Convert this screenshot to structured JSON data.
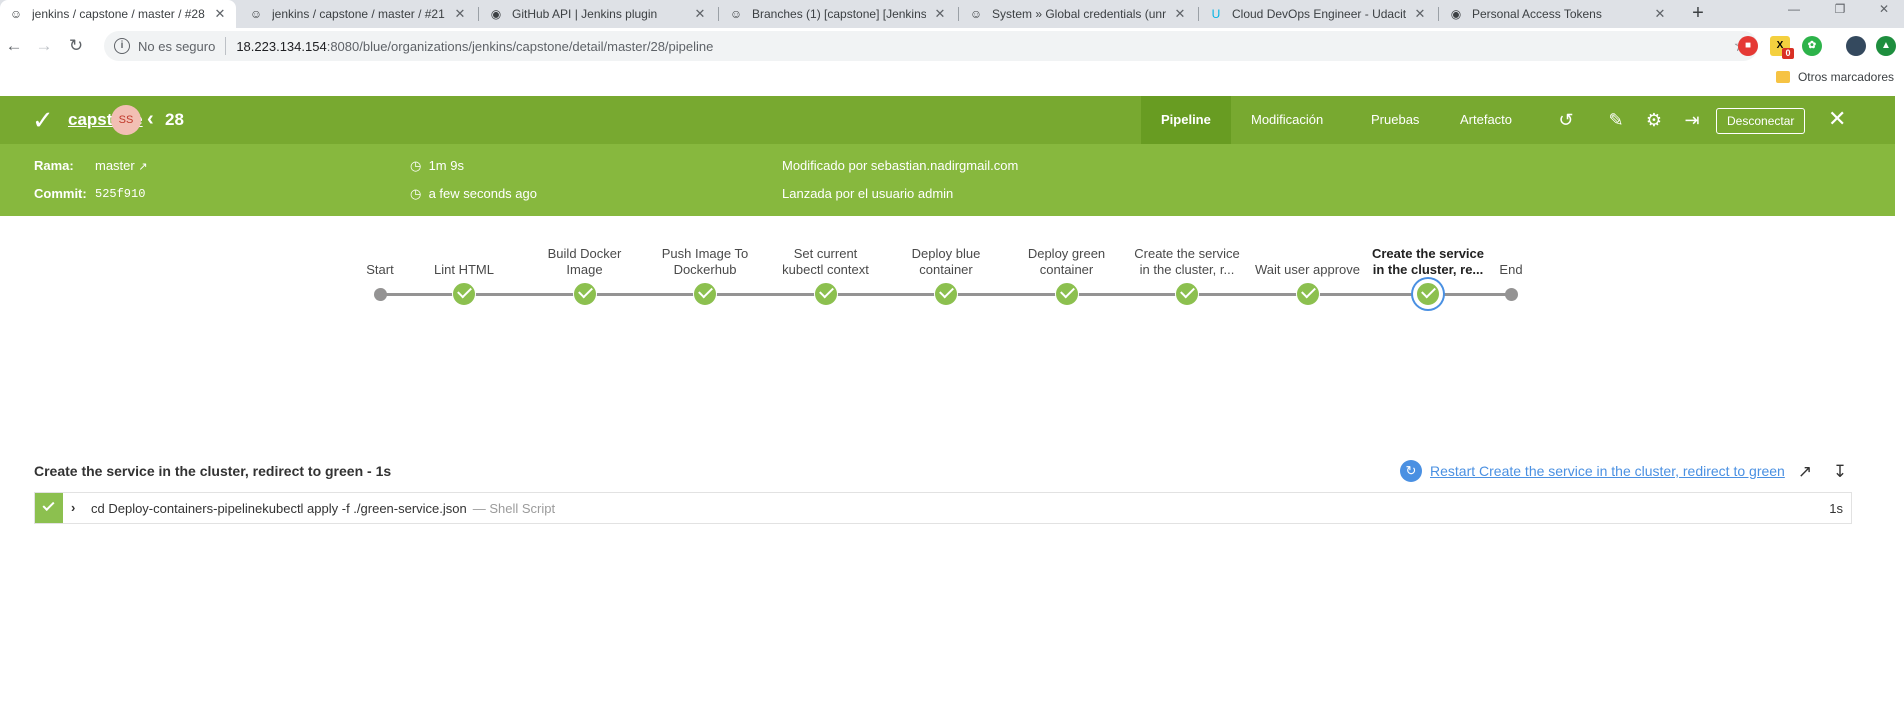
{
  "browser": {
    "tabs": [
      {
        "title": "jenkins / capstone / master / #28",
        "icon": "jenkins-icon",
        "active": true
      },
      {
        "title": "jenkins / capstone / master / #21",
        "icon": "jenkins-icon",
        "active": false
      },
      {
        "title": "GitHub API | Jenkins plugin",
        "icon": "jenkins-plugin-icon",
        "active": false
      },
      {
        "title": "Branches (1) [capstone] [Jenkins]",
        "icon": "jenkins-icon",
        "active": false
      },
      {
        "title": "System » Global credentials (unre",
        "icon": "jenkins-icon",
        "active": false
      },
      {
        "title": "Cloud DevOps Engineer - Udacity",
        "icon": "udacity-icon",
        "active": false
      },
      {
        "title": "Personal Access Tokens",
        "icon": "github-icon",
        "active": false
      }
    ],
    "new_tab": "+",
    "address": {
      "security": "No es seguro",
      "url_host": "18.223.134.154",
      "url_rest": ":8080/blue/organizations/jenkins/capstone/detail/master/28/pipeline"
    },
    "bookmarks_folder": "Otros marcadores",
    "extension_badge": "0"
  },
  "header": {
    "project": "capstone",
    "avatar_initials": "SS",
    "run_number": "28",
    "tabs": [
      "Pipeline",
      "Modificación",
      "Pruebas",
      "Artefacto"
    ],
    "active_tab": "Pipeline",
    "logout_label": "Desconectar"
  },
  "meta": {
    "branch_label": "Rama:",
    "branch": "master",
    "commit_label": "Commit:",
    "commit": "525f910",
    "duration": "1m 9s",
    "started": "a few seconds ago",
    "changes": "Modificado por sebastian.nadirgmail.com",
    "trigger": "Lanzada por el usuario admin"
  },
  "pipeline": {
    "start_label": "Start",
    "end_label": "End",
    "stages": [
      {
        "label": [
          "Lint HTML"
        ],
        "status": "success"
      },
      {
        "label": [
          "Build Docker",
          "Image"
        ],
        "status": "success"
      },
      {
        "label": [
          "Push Image To",
          "Dockerhub"
        ],
        "status": "success"
      },
      {
        "label": [
          "Set current",
          "kubectl context"
        ],
        "status": "success"
      },
      {
        "label": [
          "Deploy blue",
          "container"
        ],
        "status": "success"
      },
      {
        "label": [
          "Deploy green",
          "container"
        ],
        "status": "success"
      },
      {
        "label": [
          "Create the service",
          "in the cluster, r..."
        ],
        "status": "success"
      },
      {
        "label": [
          "Wait user approve"
        ],
        "status": "success"
      },
      {
        "label": [
          "Create the service",
          "in the cluster, re..."
        ],
        "status": "success",
        "selected": true
      }
    ]
  },
  "steps": {
    "title": "Create the service in the cluster, redirect to green - 1s",
    "restart_label": "Restart Create the service in the cluster, redirect to green",
    "items": [
      {
        "command": "cd Deploy-containers-pipelinekubectl apply -f ./green-service.json",
        "kind": "— Shell Script",
        "duration": "1s",
        "status": "success"
      }
    ]
  },
  "colors": {
    "header": "#78a930",
    "meta": "#87b83e",
    "success": "#8cc04f",
    "link": "#4a90e2"
  }
}
